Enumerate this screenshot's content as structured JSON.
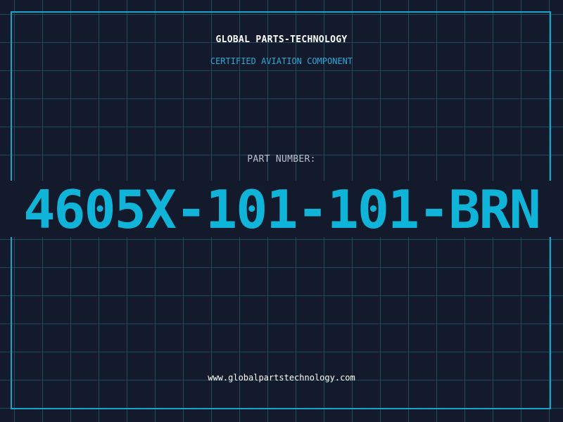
{
  "brand": {
    "name": "GLOBAL PARTS-TECHNOLOGY",
    "tagline": "CERTIFIED AVIATION COMPONENT"
  },
  "part": {
    "label": "PART NUMBER:",
    "number": "4605X-101-101-BRN"
  },
  "footer": {
    "url": "www.globalpartstechnology.com"
  },
  "colors": {
    "background": "#121a2c",
    "grid": "#1e4a5e",
    "accent": "#0fb4d8",
    "frame": "#1aa3c8"
  }
}
